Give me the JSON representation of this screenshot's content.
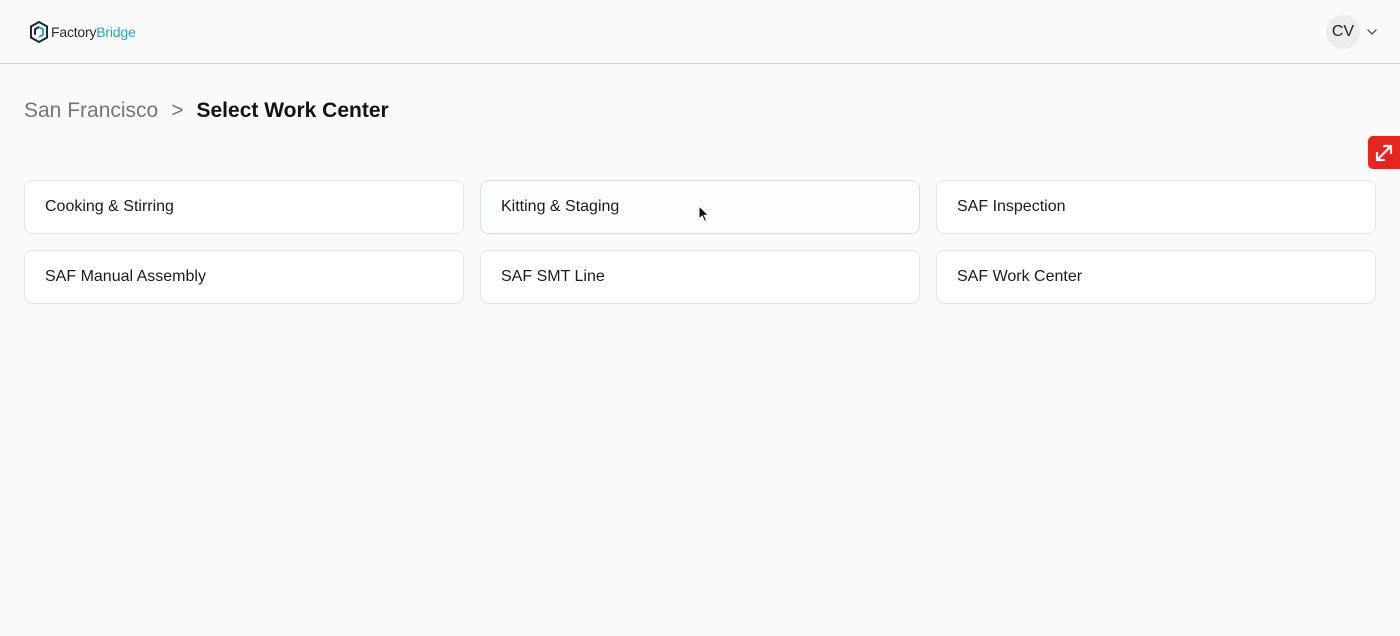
{
  "header": {
    "logo": {
      "part1": "Factory",
      "part2": "Bridge"
    },
    "user": {
      "initials": "CV"
    }
  },
  "breadcrumb": {
    "parent": "San Francisco",
    "separator": ">",
    "current": "Select Work Center"
  },
  "work_centers": [
    {
      "label": "Cooking & Stirring"
    },
    {
      "label": "Kitting & Staging"
    },
    {
      "label": "SAF Inspection"
    },
    {
      "label": "SAF Manual Assembly"
    },
    {
      "label": "SAF SMT Line"
    },
    {
      "label": "SAF Work Center"
    }
  ],
  "colors": {
    "brand_dark": "#1f2a36",
    "brand_accent": "#2aa3c9",
    "side_tab": "#e5251e"
  },
  "icons": {
    "logo": "factorybridge-logo-icon",
    "user_menu": "chevron-down-icon",
    "side_tab": "expand-arrows-icon"
  }
}
